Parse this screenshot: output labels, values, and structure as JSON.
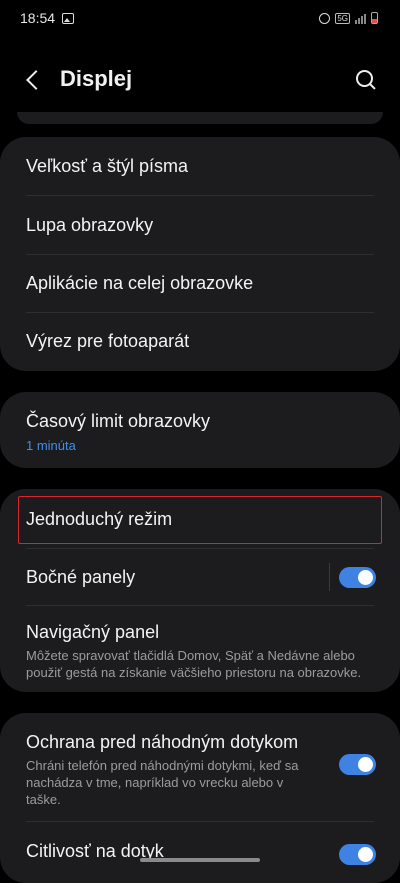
{
  "status_bar": {
    "time": "18:54",
    "image_icon": "image-icon",
    "alarm_icon": "alarm-icon",
    "network": "5G",
    "signal_icon": "signal-icon",
    "battery_icon": "battery-icon"
  },
  "header": {
    "back_icon": "chevron-left-icon",
    "title": "Displej",
    "search_icon": "search-icon"
  },
  "card1": {
    "items": [
      {
        "label": "Veľkosť a štýl písma"
      },
      {
        "label": "Lupa obrazovky"
      },
      {
        "label": "Aplikácie na celej obrazovke"
      },
      {
        "label": "Výrez pre fotoaparát"
      }
    ]
  },
  "card2": {
    "label": "Časový limit obrazovky",
    "value": "1 minúta"
  },
  "card3": {
    "easy_mode": {
      "label": "Jednoduchý režim"
    },
    "edge_panels": {
      "label": "Bočné panely",
      "enabled": true
    },
    "nav_bar": {
      "label": "Navigačný panel",
      "desc": "Môžete spravovať tlačidlá Domov, Späť a Nedávne alebo použiť gestá na získanie väčšieho priestoru na obrazovke."
    }
  },
  "card4": {
    "accidental_touch": {
      "label": "Ochrana pred náhodným dotykom",
      "desc": "Chráni telefón pred náhodnými dotykmi, keď sa nachádza v tme, napríklad vo vrecku alebo v taške.",
      "enabled": true
    },
    "touch_sensitivity": {
      "label": "Citlivosť na dotyk"
    }
  },
  "colors": {
    "background": "#000000",
    "card": "#1c1c1e",
    "accent": "#3e82e4",
    "highlight": "#d6262c"
  }
}
